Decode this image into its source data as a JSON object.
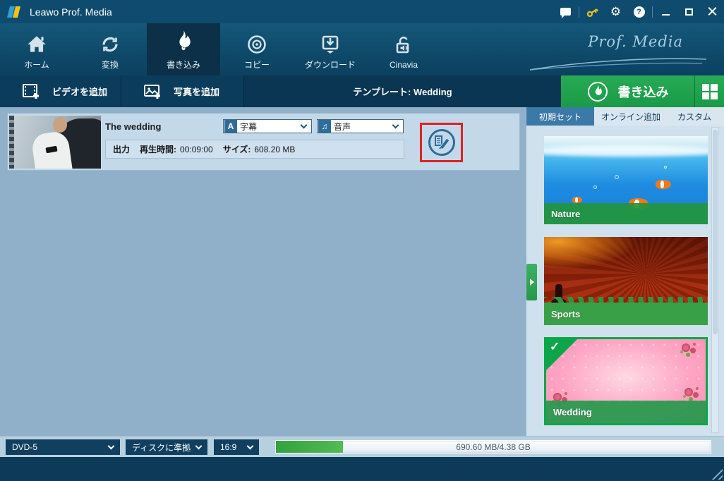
{
  "window": {
    "title": "Leawo Prof. Media"
  },
  "titlebar": {
    "gear_glyph": "⚙",
    "help_glyph": "?"
  },
  "nav": {
    "items": [
      {
        "label": "ホーム",
        "icon": "home-icon"
      },
      {
        "label": "変換",
        "icon": "convert-icon"
      },
      {
        "label": "書き込み",
        "icon": "burn-icon",
        "selected": true
      },
      {
        "label": "コピー",
        "icon": "copy-icon"
      },
      {
        "label": "ダウンロード",
        "icon": "download-icon"
      },
      {
        "label": "Cinavia",
        "icon": "cinavia-icon"
      }
    ],
    "brand": "Prof. Media"
  },
  "toolbar": {
    "add_video": "ビデオを追加",
    "add_photo": "写真を追加",
    "template": "テンプレート: Wedding",
    "burn": "書き込み"
  },
  "video": {
    "title": "The wedding",
    "subtitle_icon_glyph": "A",
    "subtitle": "字幕",
    "audio_icon_glyph": "♫",
    "audio": "音声",
    "output": "出力",
    "duration_label": "再生時間:",
    "duration": "00:09:00",
    "size_label": "サイズ:",
    "size": "608.20 MB"
  },
  "sidebar": {
    "tabs": [
      "初期セット",
      "オンライン追加",
      "カスタム"
    ],
    "templates": [
      {
        "name": "Nature",
        "selected": false
      },
      {
        "name": "Sports",
        "selected": false
      },
      {
        "name": "Wedding",
        "selected": true
      }
    ],
    "check_glyph": "✓"
  },
  "bottom": {
    "disc": "DVD-5",
    "fit": "ディスクに準拠",
    "aspect": "16:9",
    "capacity": "690.60 MB/4.38 GB",
    "progress_percent": 15.4
  },
  "colors": {
    "accent_green": "#1a9a47",
    "annotation_red": "#e0211d"
  }
}
